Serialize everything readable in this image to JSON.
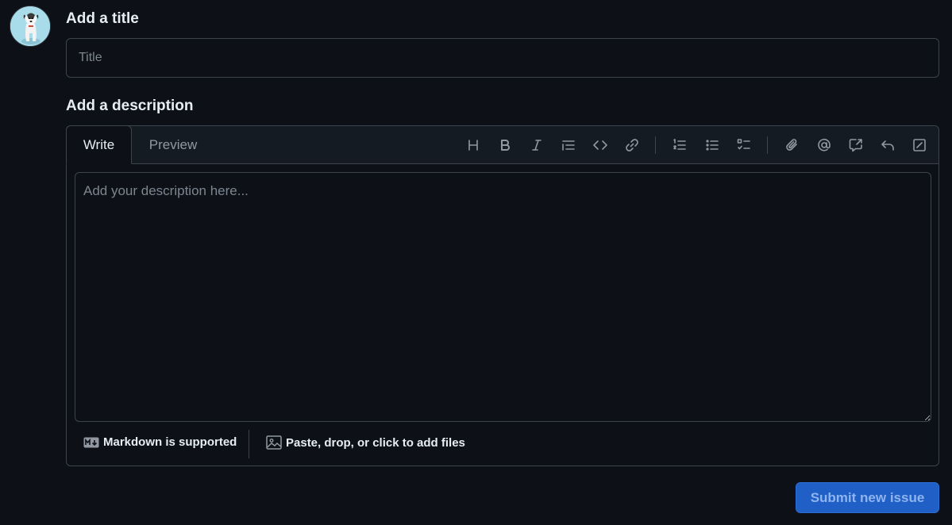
{
  "avatar": {
    "alt": "user avatar",
    "bg_color": "#a9dcea"
  },
  "title_section": {
    "heading": "Add a title",
    "placeholder": "Title",
    "value": ""
  },
  "description_section": {
    "heading": "Add a description",
    "tabs": [
      {
        "label": "Write",
        "active": true
      },
      {
        "label": "Preview",
        "active": false
      }
    ],
    "toolbar_icons": [
      "heading-icon",
      "bold-icon",
      "italic-icon",
      "quote-icon",
      "code-icon",
      "link-icon",
      "ordered-list-icon",
      "unordered-list-icon",
      "task-list-icon",
      "attach-icon",
      "mention-icon",
      "reference-icon",
      "reply-icon",
      "slash-command-icon"
    ],
    "placeholder": "Add your description here...",
    "value": "",
    "footer": {
      "markdown_label": "Markdown is supported",
      "attach_label": "Paste, drop, or click to add files"
    }
  },
  "submit": {
    "label": "Submit new issue"
  },
  "colors": {
    "background": "#0d1117",
    "border": "#3d444d",
    "text": "#e6edf3",
    "muted": "#9198a1",
    "submit_bg": "#1f5fc6"
  }
}
